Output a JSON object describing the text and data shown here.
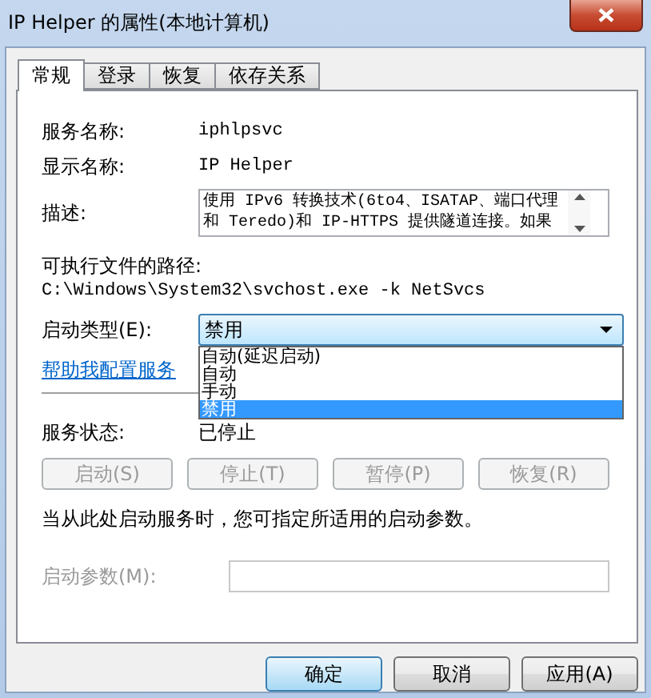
{
  "window": {
    "title": "IP Helper 的属性(本地计算机)"
  },
  "tabs": [
    {
      "label": "常规",
      "selected": true
    },
    {
      "label": "登录",
      "selected": false
    },
    {
      "label": "恢复",
      "selected": false
    },
    {
      "label": "依存关系",
      "selected": false
    }
  ],
  "fields": [
    {
      "label": "服务名称:",
      "value": "iphlpsvc"
    },
    {
      "label": "显示名称:",
      "value": "IP Helper"
    }
  ],
  "description": {
    "label": "描述:",
    "value": "使用 IPv6 转换技术(6to4、ISATAP、端口代理和 Teredo)和 IP-HTTPS 提供隧道连接。如果"
  },
  "path": {
    "label": "可执行文件的路径:",
    "value": "C:\\Windows\\System32\\svchost.exe -k NetSvcs"
  },
  "startup_type": {
    "label": "启动类型(E):",
    "value": "禁用",
    "expanded": true,
    "options": [
      {
        "label": "自动(延迟启动)",
        "selected": false
      },
      {
        "label": "自动",
        "selected": false
      },
      {
        "label": "手动",
        "selected": false
      },
      {
        "label": "禁用",
        "selected": true
      }
    ]
  },
  "help_link": "帮助我配置服务",
  "service_status": {
    "label": "服务状态:",
    "value": "已停止"
  },
  "service_buttons": [
    {
      "label": "启动(S)",
      "disabled": true
    },
    {
      "label": "停止(T)",
      "disabled": true
    },
    {
      "label": "暂停(P)",
      "disabled": true
    },
    {
      "label": "恢复(R)",
      "disabled": true
    }
  ],
  "hint": "当从此处启动服务时，您可指定所适用的启动参数。",
  "start_params": {
    "label": "启动参数(M):",
    "disabled": true
  },
  "buttons": [
    {
      "label": "确定",
      "default": true
    },
    {
      "label": "取消",
      "default": false
    },
    {
      "label": "应用(A)",
      "default": false
    }
  ]
}
